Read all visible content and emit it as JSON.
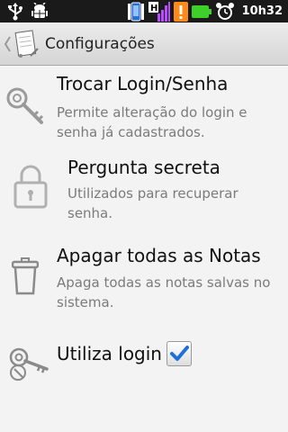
{
  "status_bar": {
    "time": "10h32",
    "icons": [
      "usb-icon",
      "android-debug-icon",
      "sim-icon",
      "signal-h-icon",
      "warning-icon",
      "battery-icon",
      "alarm-icon"
    ]
  },
  "header": {
    "title": "Configurações",
    "icons": [
      "back-chevron-icon",
      "app-notepad-icon"
    ]
  },
  "settings": [
    {
      "title": "Trocar Login/Senha",
      "description": "Permite alteração do login e senha já cadastrados.",
      "icon": "key-icon"
    },
    {
      "title": "Pergunta secreta",
      "description": "Utilizados para recuperar senha.",
      "icon": "padlock-icon"
    },
    {
      "title": "Apagar todas as Notas",
      "description": "Apaga todas as notas salvas no sistema.",
      "icon": "trash-icon"
    },
    {
      "title": "Utiliza login",
      "icon": "keys-icon",
      "checked": true
    }
  ],
  "colors": {
    "status_bar_bg": "#1a1a1a",
    "checkbox_check": "#1f6fd8",
    "battery": "#3ecf2a",
    "warning": "#ff8a1a"
  }
}
